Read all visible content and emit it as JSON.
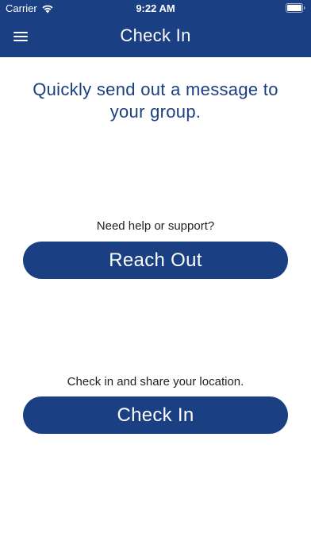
{
  "status_bar": {
    "carrier": "Carrier",
    "time": "9:22 AM",
    "wifi_icon": "wifi-icon",
    "battery_icon": "battery-icon"
  },
  "nav": {
    "menu_icon": "hamburger-menu-icon",
    "title": "Check In"
  },
  "main": {
    "intro": "Quickly send out a message to your group.",
    "support_prompt": "Need help or support?",
    "reach_out_label": "Reach Out",
    "checkin_prompt": "Check in and share your location.",
    "check_in_label": "Check In"
  },
  "colors": {
    "brand_blue": "#1a3f82",
    "background": "#ffffff",
    "prompt_text": "#222222"
  }
}
